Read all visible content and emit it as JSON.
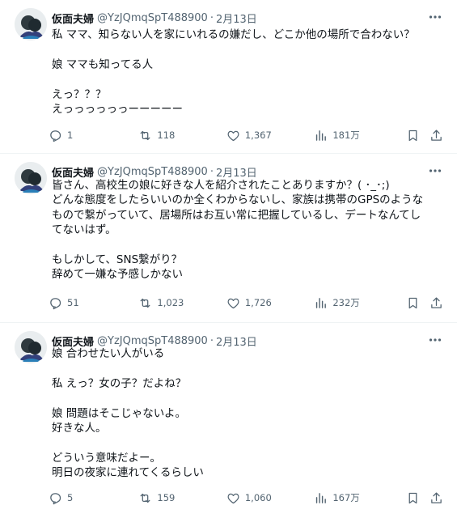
{
  "tweets": [
    {
      "name": "仮面夫婦",
      "handle": "@YzJQmqSpT488900",
      "dot": "·",
      "date": "2月13日",
      "lines": [
        "私 ママ、知らない人を家にいれるの嫌だし、どこか他の場所で合わない？",
        "",
        "娘 ママも知ってる人",
        "",
        "えっ？？？",
        "えっっっっっっーーーーー"
      ],
      "replies": "1",
      "retweets": "118",
      "likes": "1,367",
      "views": "181万"
    },
    {
      "name": "仮面夫婦",
      "handle": "@YzJQmqSpT488900",
      "dot": "·",
      "date": "2月13日",
      "lines": [
        "皆さん、高校生の娘に好きな人を紹介されたことありますか？( ･_･;)",
        "どんな態度をしたらいいのか全くわからないし、家族は携帯のGPSのような",
        "もので繋がっていて、居場所はお互い常に把握しているし、デートなんてし",
        "てないはず。",
        "",
        "もしかして、SNS繋がり？",
        "辞めて一嫌な予感しかない"
      ],
      "replies": "51",
      "retweets": "1,023",
      "likes": "1,726",
      "views": "232万"
    },
    {
      "name": "仮面夫婦",
      "handle": "@YzJQmqSpT488900",
      "dot": "·",
      "date": "2月13日",
      "lines": [
        "娘 合わせたい人がいる",
        "",
        "私 えっ？女の子？だよね？",
        "",
        "娘 問題はそこじゃないよ。",
        "好きな人。",
        "",
        "どういう意味だよー。",
        "明日の夜家に連れてくるらしい"
      ],
      "replies": "5",
      "retweets": "159",
      "likes": "1,060",
      "views": "167万"
    }
  ],
  "icons": {
    "more": "more-icon",
    "reply": "reply-icon",
    "retweet": "retweet-icon",
    "like": "heart-icon",
    "views": "views-icon",
    "bookmark": "bookmark-icon",
    "share": "share-icon"
  },
  "colors": {
    "text": "#0f1419",
    "muted": "#536471",
    "divider": "#eff3f4"
  }
}
